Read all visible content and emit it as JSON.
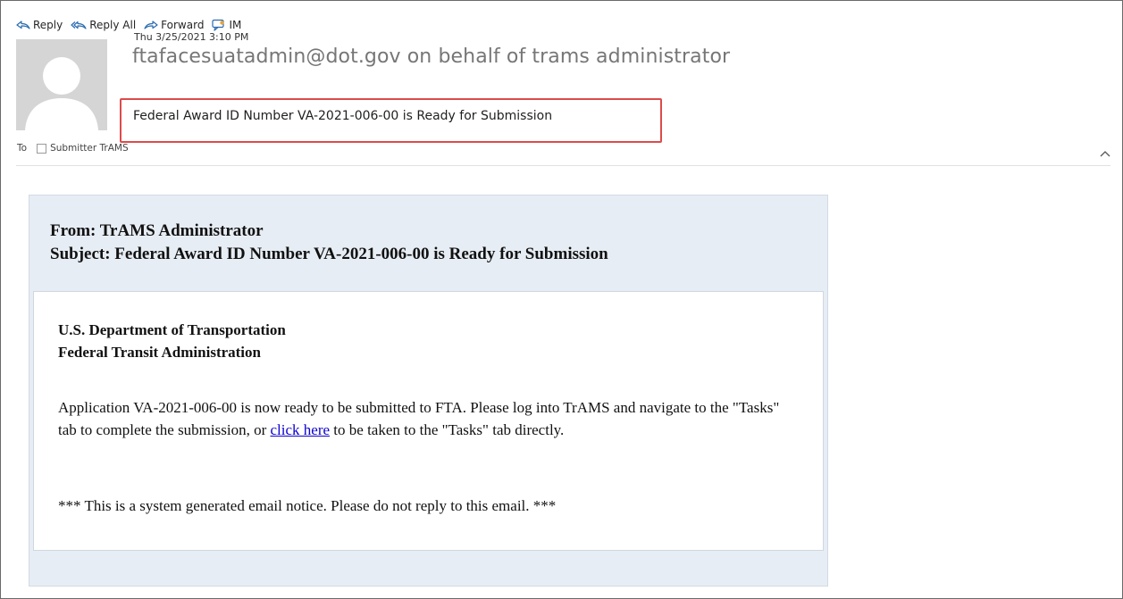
{
  "toolbar": {
    "reply": "Reply",
    "reply_all": "Reply All",
    "forward": "Forward",
    "im": "IM"
  },
  "message": {
    "date": "Thu 3/25/2021 3:10 PM",
    "sender": "ftafacesuatadmin@dot.gov on behalf of trams administrator",
    "subject": "Federal Award ID Number VA-2021-006-00 is Ready for Submission",
    "to_label": "To",
    "recipient": "Submitter TrAMS"
  },
  "email": {
    "from_line": "From: TrAMS Administrator",
    "subject_line": "Subject: Federal Award ID Number VA-2021-006-00 is Ready for Submission",
    "dept_line1": "U.S. Department of Transportation",
    "dept_line2": "Federal Transit Administration",
    "body_part1": "Application VA-2021-006-00 is now ready to be submitted to FTA. Please log into TrAMS and navigate to the \"Tasks\" tab to complete the submission, or ",
    "link_text": "click here",
    "body_part2": " to be taken to the \"Tasks\" tab directly.",
    "notice": "*** This is a system generated email notice. Please do not reply to this email. ***"
  },
  "colors": {
    "highlight_box": "#dd4b4b",
    "link": "#0b00cc",
    "email_panel": "#e7edf4",
    "icon_blue": "#2b6cb0"
  }
}
